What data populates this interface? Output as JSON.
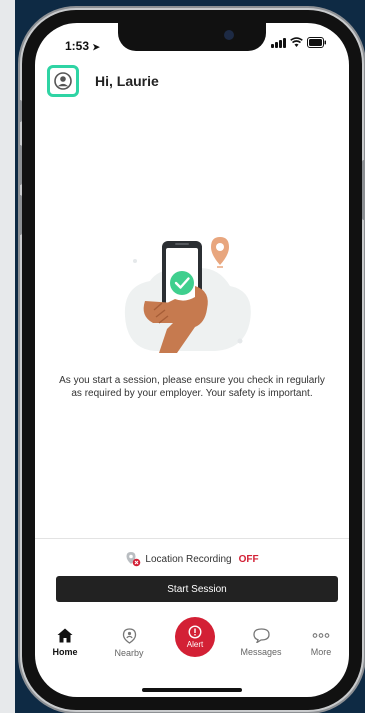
{
  "status_bar": {
    "time": "1:53"
  },
  "header": {
    "greeting": "Hi, Laurie"
  },
  "main": {
    "message": "As you start a session, please ensure you check in regularly as required by your employer. Your safety is important."
  },
  "location": {
    "label": "Location Recording",
    "state": "OFF"
  },
  "actions": {
    "start_session": "Start Session"
  },
  "tabbar": {
    "home": "Home",
    "nearby": "Nearby",
    "alert": "Alert",
    "messages": "Messages",
    "more": "More"
  },
  "colors": {
    "accent_teal": "#2fd4a4",
    "alert_red": "#d32035",
    "button_dark": "#222222",
    "backdrop_navy": "#0e2a44"
  }
}
